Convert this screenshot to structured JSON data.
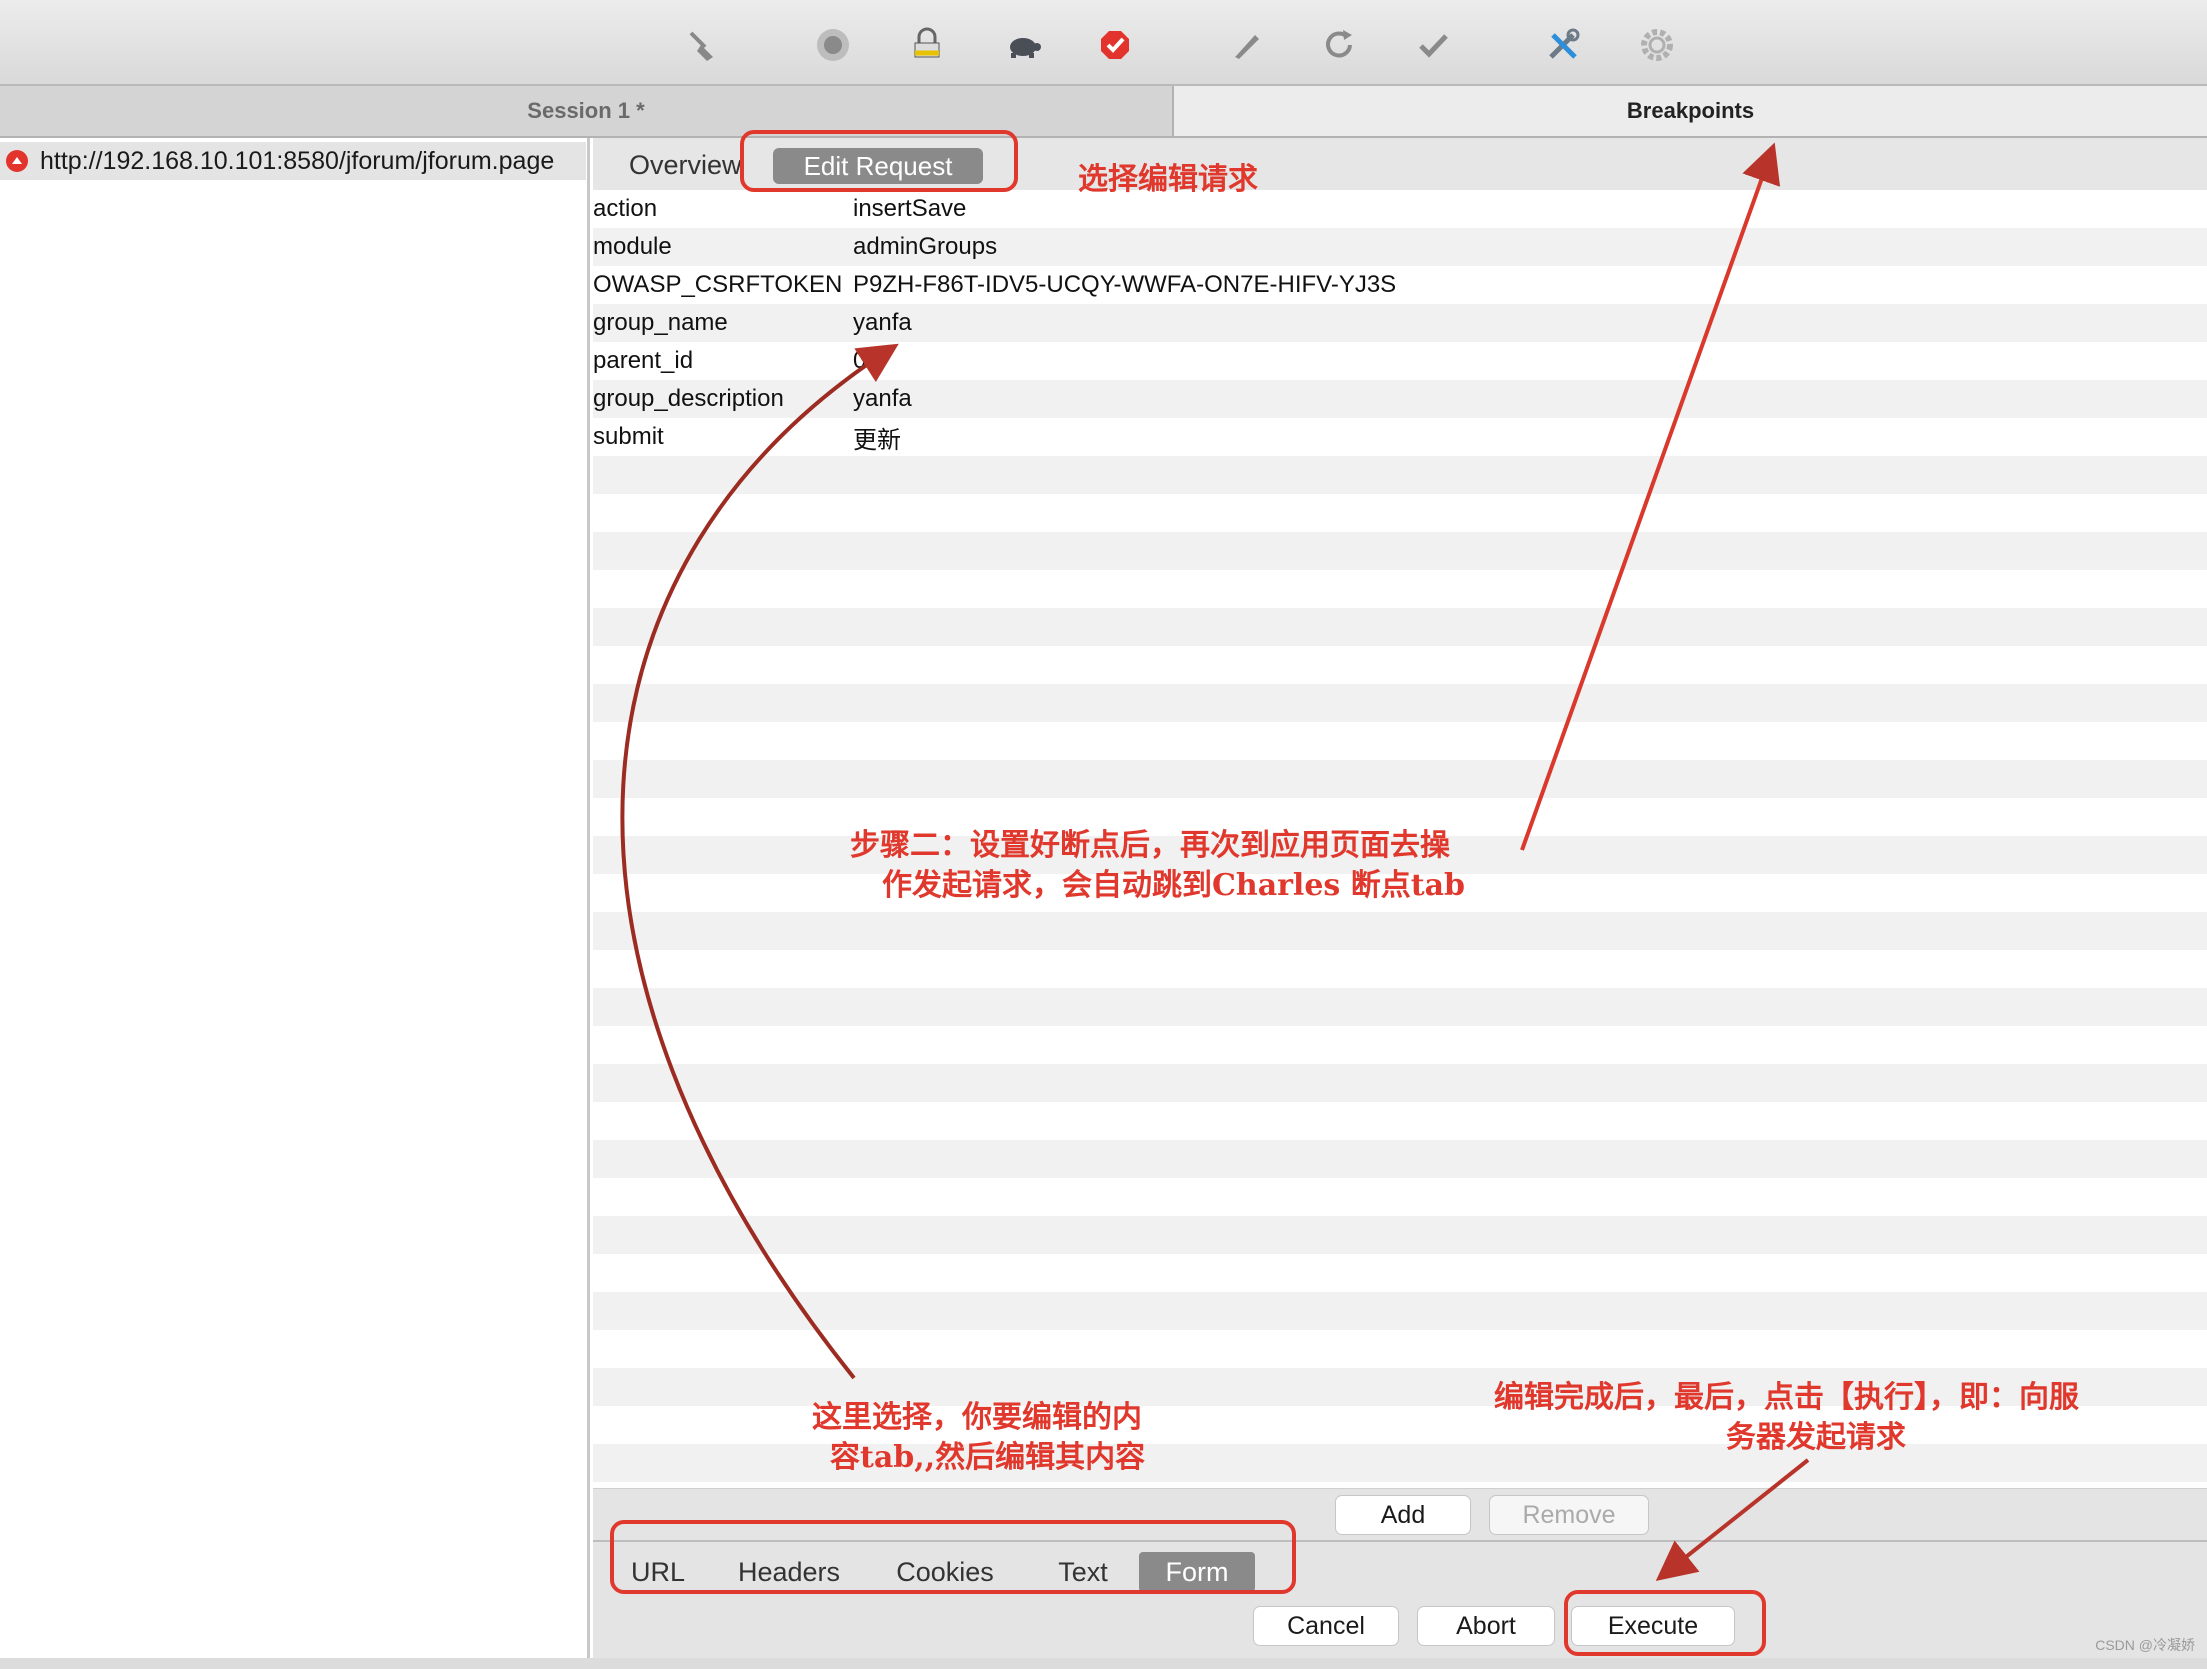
{
  "toolbar": {
    "icons": [
      "broom-icon",
      "record-icon",
      "throttle-lock-icon",
      "turtle-icon",
      "breakpoint-icon",
      "pen-icon",
      "refresh-icon",
      "check-icon",
      "tools-icon",
      "settings-gear-icon"
    ]
  },
  "tabs": {
    "session": "Session 1 *",
    "breakpoints": "Breakpoints"
  },
  "tree": {
    "url": "http://192.168.10.101:8580/jforum/jforum.page"
  },
  "request_tabs": {
    "overview": "Overview",
    "edit_request": "Edit Request"
  },
  "form_rows": [
    {
      "key": "action",
      "value": "insertSave"
    },
    {
      "key": "module",
      "value": "adminGroups"
    },
    {
      "key": "OWASP_CSRFTOKEN",
      "value": "P9ZH-F86T-IDV5-UCQY-WWFA-ON7E-HIFV-YJ3S"
    },
    {
      "key": "group_name",
      "value": "yanfa"
    },
    {
      "key": "parent_id",
      "value": "0"
    },
    {
      "key": "group_description",
      "value": "yanfa"
    },
    {
      "key": "submit",
      "value": "更新"
    }
  ],
  "form_buttons": {
    "add": "Add",
    "remove": "Remove"
  },
  "bottom_tabs": [
    "URL",
    "Headers",
    "Cookies",
    "Text",
    "Form"
  ],
  "actions": {
    "cancel": "Cancel",
    "abort": "Abort",
    "execute": "Execute"
  },
  "annotations": {
    "edit_request": "选择编辑请求",
    "step2_line1": "步骤二：设置好断点后，再次到应用页面去操",
    "step2_line2": "作发起请求，会自动跳到Charles 断点tab",
    "tab_select_line1": "这里选择，你要编辑的内",
    "tab_select_line2": "容tab,,然后编辑其内容",
    "execute_line1": "编辑完成后，最后，点击【执行】，即：向服",
    "execute_line2": "务器发起请求"
  },
  "colors": {
    "annotation": "#e0382c",
    "selected_tab": "#8a8a8a",
    "breakpoint": "#e2342d"
  },
  "watermark": "CSDN @冷凝娇"
}
